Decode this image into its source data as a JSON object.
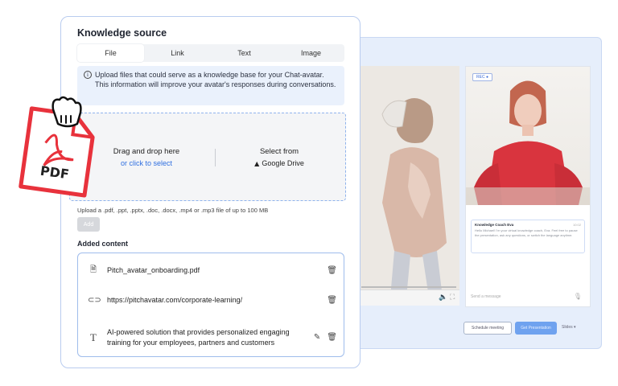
{
  "knowledge": {
    "title": "Knowledge source",
    "tabs": [
      {
        "label": "File",
        "active": true
      },
      {
        "label": "Link",
        "active": false
      },
      {
        "label": "Text",
        "active": false
      },
      {
        "label": "Image",
        "active": false
      }
    ],
    "notice": "Upload files that could serve as a knowledge base for your Chat-avatar. This information will improve your avatar's responses during conversations.",
    "dropzone": {
      "title": "Drag and drop here",
      "link": "or click to select",
      "alt_title": "Select from",
      "alt_source": "Google Drive"
    },
    "upload_hint": "Upload a .pdf, .ppt, .pptx, .doc, .docx, .mp4 or .mp3 file of up to 100 MB",
    "add_label": "Add",
    "added_title": "Added content",
    "items": [
      {
        "icon": "document-icon",
        "text": "Pitch_avatar_onboarding.pdf"
      },
      {
        "icon": "link-icon",
        "text": "https://pitchavatar.com/corporate-learning/"
      },
      {
        "icon": "text-icon",
        "text": "AI-powered solution that provides personalized engaging training for your employees, partners and customers"
      }
    ]
  },
  "pdf_sticker": {
    "label": "PDF"
  },
  "background": {
    "chat_card_title": "Knowledge Coach Eva",
    "chat_card_text": "Hello Michael! I'm your virtual knowledge coach, Eva. Feel free to pause the presentation, ask any questions, or switch the language anytime.",
    "chat_placeholder": "Send a message",
    "schedule_label": "Schedule meeting",
    "presentation_label": "Get Presentation",
    "slides_label": "Slides"
  },
  "colors": {
    "accent": "#2f6fe0",
    "card_border": "#b9ccef",
    "pdf_red": "#e8323c"
  }
}
